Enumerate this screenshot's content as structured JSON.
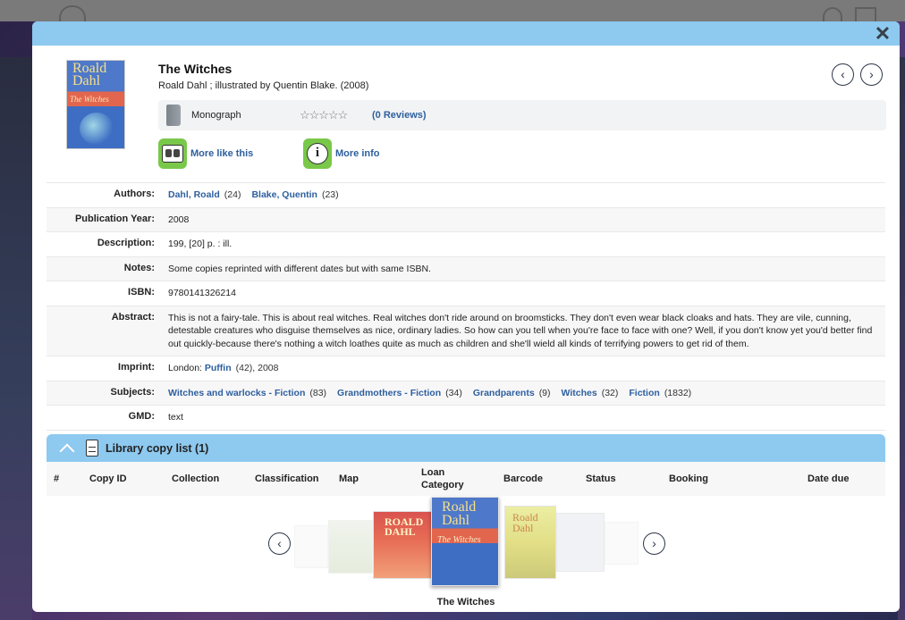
{
  "header": {
    "close_label": "✕"
  },
  "book": {
    "title": "The Witches",
    "byline": "Roald Dahl ; illustrated by Quentin Blake.  (2008)",
    "cover_title": "Roald Dahl",
    "cover_subtitle": "The Witches",
    "type_label": "Monograph",
    "stars": "☆☆☆☆☆",
    "reviews_label": "(0 Reviews)",
    "more_like_label": "More like this",
    "more_info_label": "More info"
  },
  "nav": {
    "prev_glyph": "‹",
    "next_glyph": "›"
  },
  "details": {
    "authors_key": "Authors:",
    "authors": [
      {
        "name": "Dahl, Roald",
        "count": "(24)"
      },
      {
        "name": "Blake, Quentin",
        "count": "(23)"
      }
    ],
    "pubyear_key": "Publication Year:",
    "pubyear": "2008",
    "description_key": "Description:",
    "description": "199, [20] p. : ill.",
    "notes_key": "Notes:",
    "notes": "Some copies reprinted with different dates but with same ISBN.",
    "isbn_key": "ISBN:",
    "isbn": "9780141326214",
    "abstract_key": "Abstract:",
    "abstract": "This is not a fairy-tale. This is about real witches. Real witches don't ride around on broomsticks. They don't even wear black cloaks and hats. They are vile, cunning, detestable creatures who disguise themselves as nice, ordinary ladies. So how can you tell when you're face to face with one? Well, if you don't know yet you'd better find out quickly-because there's nothing a witch loathes quite as much as children and she'll wield all kinds of terrifying powers to get rid of them.",
    "imprint_key": "Imprint:",
    "imprint_prefix": "London: ",
    "imprint_publisher": "Puffin",
    "imprint_suffix": "(42), 2008",
    "subjects_key": "Subjects:",
    "subjects": [
      {
        "name": "Witches and warlocks - Fiction",
        "count": "(83)"
      },
      {
        "name": "Grandmothers - Fiction",
        "count": "(34)"
      },
      {
        "name": "Grandparents",
        "count": "(9)"
      },
      {
        "name": "Witches",
        "count": "(32)"
      },
      {
        "name": "Fiction",
        "count": "(1832)"
      }
    ],
    "gmd_key": "GMD:",
    "gmd": "text"
  },
  "copy_list": {
    "title": "Library copy list (1)",
    "columns": [
      "#",
      "Copy ID",
      "Collection",
      "Classification",
      "Map",
      "Loan Category",
      "Barcode",
      "Status",
      "Booking",
      "Date due"
    ]
  },
  "carousel": {
    "caption": "The Witches",
    "items": [
      {
        "title": ""
      },
      {
        "title": ""
      },
      {
        "title": "ROALD DAHL"
      },
      {
        "title": "Roald Dahl",
        "subtitle": "The Witches"
      },
      {
        "title": "Roald Dahl"
      },
      {
        "title": ""
      },
      {
        "title": ""
      }
    ]
  }
}
